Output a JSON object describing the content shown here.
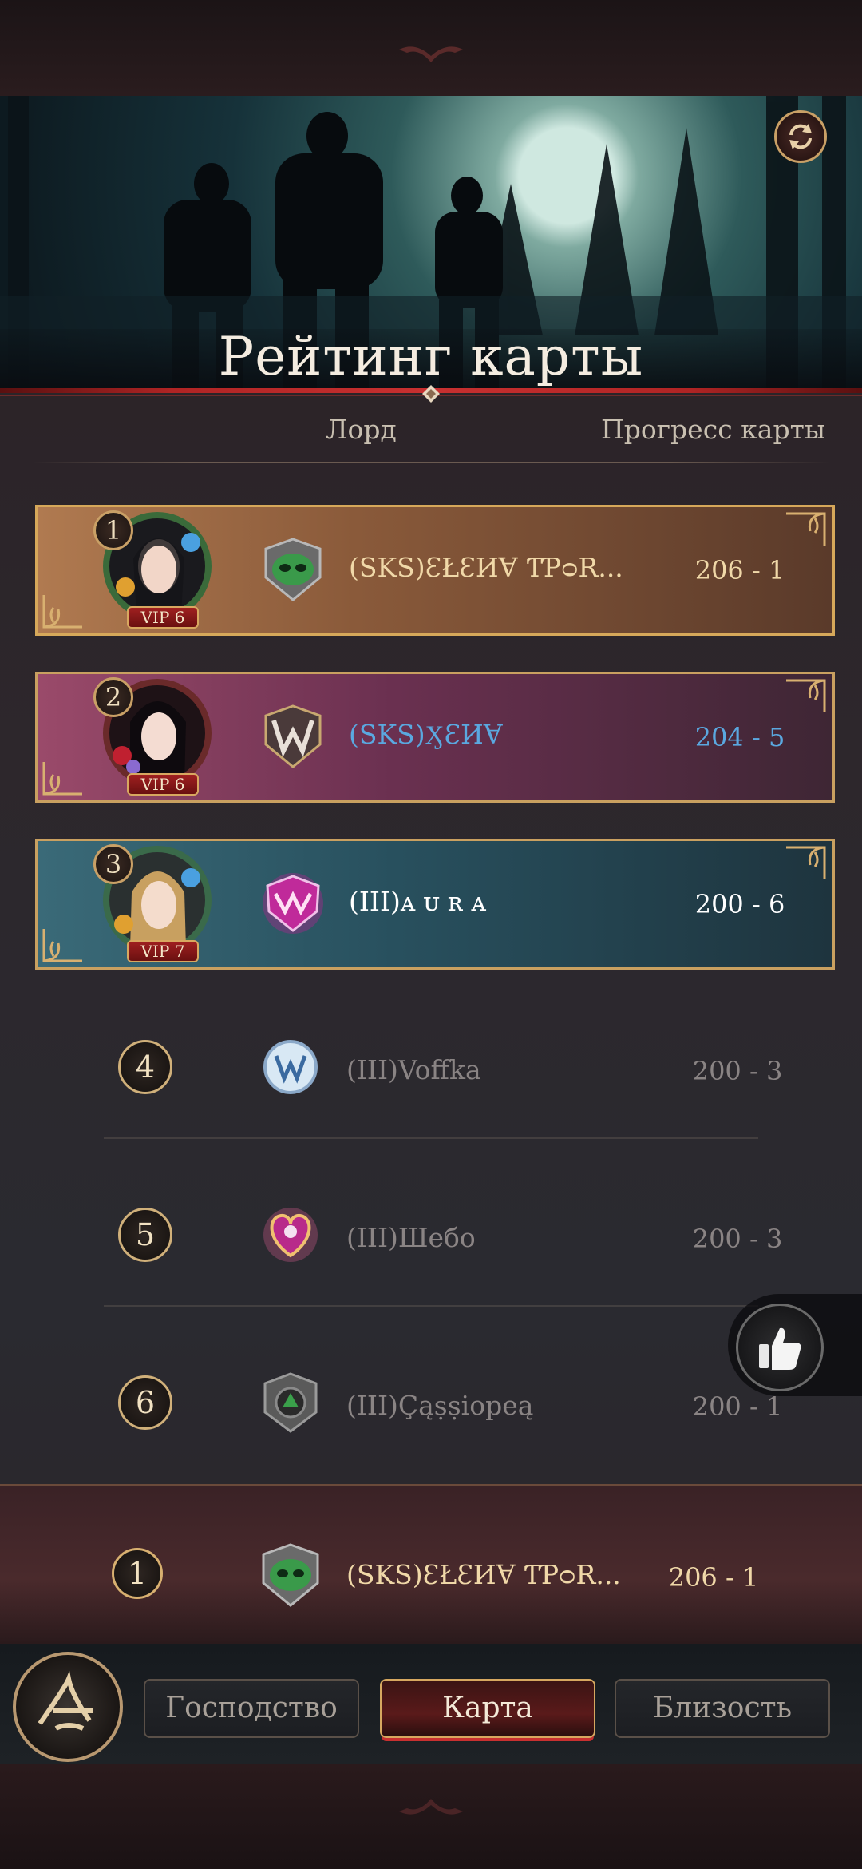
{
  "header": {
    "title": "Рейтинг карты",
    "col_lord": "Лорд",
    "col_progress": "Прогресс карты"
  },
  "rankings": [
    {
      "rank": "1",
      "vip": "VIP 6",
      "name": "(SKS)ƐŁƐИⱯ ƬƤᴑR...",
      "score": "206 - 1",
      "name_color": "#f0d8a8",
      "score_color": "#f0d8a8"
    },
    {
      "rank": "2",
      "vip": "VIP 6",
      "name": "(SKS)ӼƐИⱯ",
      "score": "204 - 5",
      "name_color": "#5aa8e0",
      "score_color": "#5aa8e0"
    },
    {
      "rank": "3",
      "vip": "VIP 7",
      "name": "(III)ᴀ ᴜ ʀ ᴀ",
      "score": "200 - 6",
      "name_color": "#ffffff",
      "score_color": "#ffffff"
    },
    {
      "rank": "4",
      "name": "(III)Voffka",
      "score": "200 - 3"
    },
    {
      "rank": "5",
      "name": "(III)Шебо",
      "score": "200 - 3"
    },
    {
      "rank": "6",
      "name": "(III)Çąṣṣiopeą",
      "score": "200 - 1"
    }
  ],
  "my_rank": {
    "rank": "1",
    "name": "(SKS)ƐŁƐИⱯ ƬƤᴑR...",
    "score": "206 - 1"
  },
  "nav": {
    "tab_dominance": "Господство",
    "tab_map": "Карта",
    "tab_closeness": "Близость",
    "active": "map"
  },
  "icons": {
    "refresh": "refresh-icon",
    "like": "thumbs-up-icon",
    "menu": "menu-emblem-icon"
  }
}
